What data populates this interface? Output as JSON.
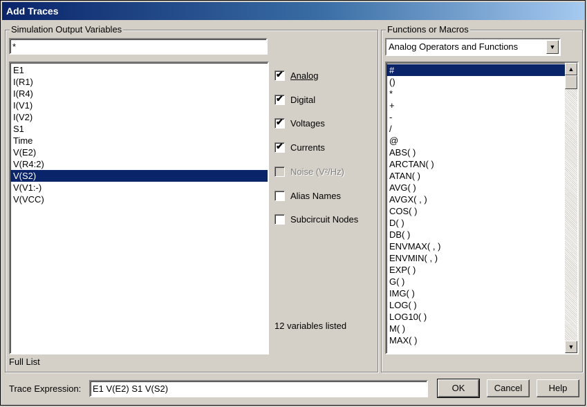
{
  "window": {
    "title": "Add Traces"
  },
  "output_vars": {
    "group_label": "Simulation Output Variables",
    "filter_value": "*",
    "items": [
      "E1",
      "I(R1)",
      "I(R4)",
      "I(V1)",
      "I(V2)",
      "S1",
      "Time",
      "V(E2)",
      "V(R4:2)",
      "V(S2)",
      "V(V1:-)",
      "V(VCC)"
    ],
    "selected_index": 9,
    "full_list_label": "Full List"
  },
  "filters": {
    "analog": {
      "label": "Analog",
      "checked": true
    },
    "digital": {
      "label": "Digital",
      "checked": true
    },
    "voltages": {
      "label": "Voltages",
      "checked": true
    },
    "currents": {
      "label": "Currents",
      "checked": true
    },
    "noise": {
      "label": "Noise (V²/Hz)",
      "checked": false,
      "disabled": true
    },
    "alias": {
      "label": "Alias Names",
      "checked": false
    },
    "subcircuit": {
      "label": "Subcircuit Nodes",
      "checked": false
    },
    "count_text": "12 variables listed"
  },
  "functions": {
    "group_label": "Functions or Macros",
    "dropdown_value": "Analog Operators and Functions",
    "items": [
      "#",
      "()",
      "*",
      "+",
      "-",
      "/",
      "@",
      "ABS( )",
      "ARCTAN( )",
      "ATAN( )",
      "AVG( )",
      "AVGX( , )",
      "COS( )",
      "D( )",
      "DB( )",
      "ENVMAX( , )",
      "ENVMIN( , )",
      "EXP( )",
      "G( )",
      "IMG( )",
      "LOG( )",
      "LOG10( )",
      "M( )",
      "MAX( )"
    ],
    "selected_index": 0
  },
  "trace": {
    "label": "Trace Expression:",
    "value": "E1 V(E2) S1 V(S2)"
  },
  "buttons": {
    "ok": "OK",
    "cancel": "Cancel",
    "help": "Help"
  },
  "icons": {
    "check": "check-icon",
    "dropdown": "chevron-down-icon",
    "scroll_up": "arrow-up-icon",
    "scroll_down": "arrow-down-icon"
  },
  "colors": {
    "titlebar_start": "#0a246a",
    "titlebar_end": "#a6caf0",
    "selection": "#0a246a",
    "face": "#d4d0c8"
  }
}
